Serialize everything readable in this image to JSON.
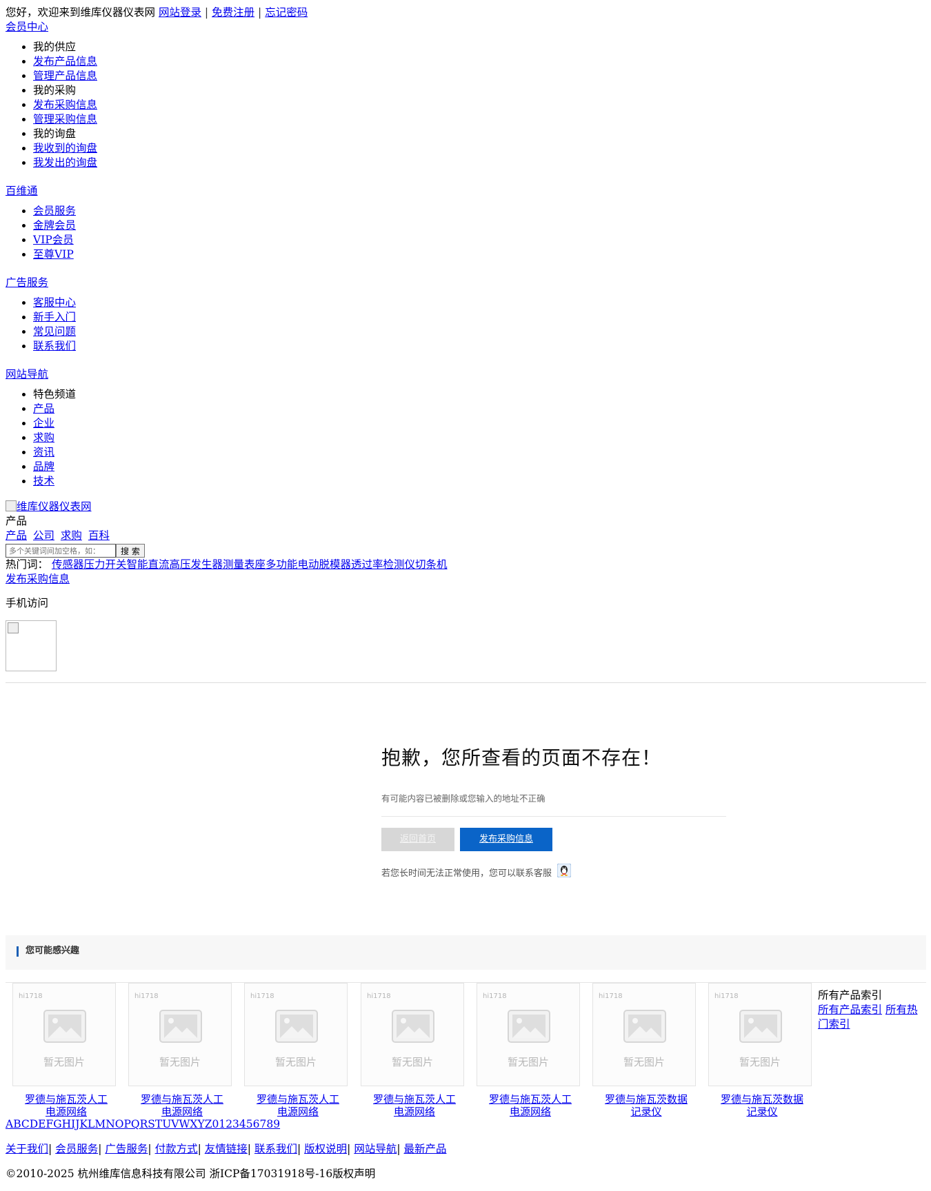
{
  "topbar": {
    "greeting": "您好，欢迎来到维库仪器仪表网",
    "login": "网站登录",
    "register": "免费注册",
    "forgot": "忘记密码",
    "sep": "|"
  },
  "member_center": {
    "title": "会员中心",
    "items": [
      {
        "label": "我的供应",
        "link": false
      },
      {
        "label": "发布产品信息",
        "link": true
      },
      {
        "label": "管理产品信息",
        "link": true
      },
      {
        "label": "我的采购",
        "link": false
      },
      {
        "label": "发布采购信息",
        "link": true
      },
      {
        "label": "管理采购信息",
        "link": true
      },
      {
        "label": "我的询盘",
        "link": false
      },
      {
        "label": "我收到的询盘",
        "link": true
      },
      {
        "label": "我发出的询盘",
        "link": true
      }
    ]
  },
  "baiweitong": {
    "title": "百维通",
    "items": [
      "会员服务",
      "金牌会员",
      "VIP会员",
      "至尊VIP"
    ]
  },
  "ad_service": {
    "title": "广告服务",
    "items": [
      "客服中心",
      "新手入门",
      "常见问题",
      "联系我们"
    ]
  },
  "site_nav": {
    "title": "网站导航",
    "items": [
      {
        "label": "特色频道",
        "link": false
      },
      {
        "label": "产品",
        "link": true
      },
      {
        "label": "企业",
        "link": true
      },
      {
        "label": "求购",
        "link": true
      },
      {
        "label": "资讯",
        "link": true
      },
      {
        "label": "品牌",
        "link": true
      },
      {
        "label": "技术",
        "link": true
      }
    ]
  },
  "logo_alt": "维库仪器仪表网",
  "search": {
    "current": "产品",
    "tabs": [
      "产品",
      "公司",
      "求购",
      "百科"
    ],
    "placeholder": "多个关键词间加空格，如：",
    "button": "搜 索"
  },
  "hot": {
    "label": "热门词：",
    "words": [
      "传感器",
      "压力开关",
      "智能直流高压发生器",
      "测量表座",
      "多功能电动脱模器",
      "透过率检测仪",
      "切条机"
    ]
  },
  "publish_purchase": "发布采购信息",
  "mobile_label": "手机访问",
  "error": {
    "title": "抱歉，您所查看的页面不存在！",
    "sub": "有可能内容已被删除或您输入的地址不正确",
    "home_btn": "返回首页",
    "publish_btn": "发布采购信息",
    "contact": "若您长时间无法正常使用，您可以联系客服"
  },
  "interest": {
    "title": "您可能感兴趣",
    "placeholder_text": "暂无图片",
    "watermark": "hi1718",
    "items": [
      "罗德与施瓦茨人工电源网络",
      "罗德与施瓦茨人工电源网络",
      "罗德与施瓦茨人工电源网络",
      "罗德与施瓦茨人工电源网络",
      "罗德与施瓦茨人工电源网络",
      "罗德与施瓦茨数据记录仪",
      "罗德与施瓦茨数据记录仪"
    ],
    "index_title": "所有产品索引",
    "index_links": [
      "所有产品索引",
      "所有热门索引"
    ]
  },
  "letters": "ABCDEFGHIJKLMNOPQRSTUVWXYZ0123456789",
  "footer": {
    "links": [
      "关于我们",
      "会员服务",
      "广告服务",
      "付款方式",
      "友情链接",
      "联系我们",
      "版权说明",
      "网站导航",
      "最新产品"
    ],
    "copyright": "©2010-2025 杭州维库信息科技有限公司 浙ICP备17031918号-16版权声明"
  },
  "colors": {
    "link": "#0000ee",
    "primary_button": "#0a64c8",
    "disabled_button": "#d7d7d7",
    "accent_bar": "#1b5fb5"
  }
}
